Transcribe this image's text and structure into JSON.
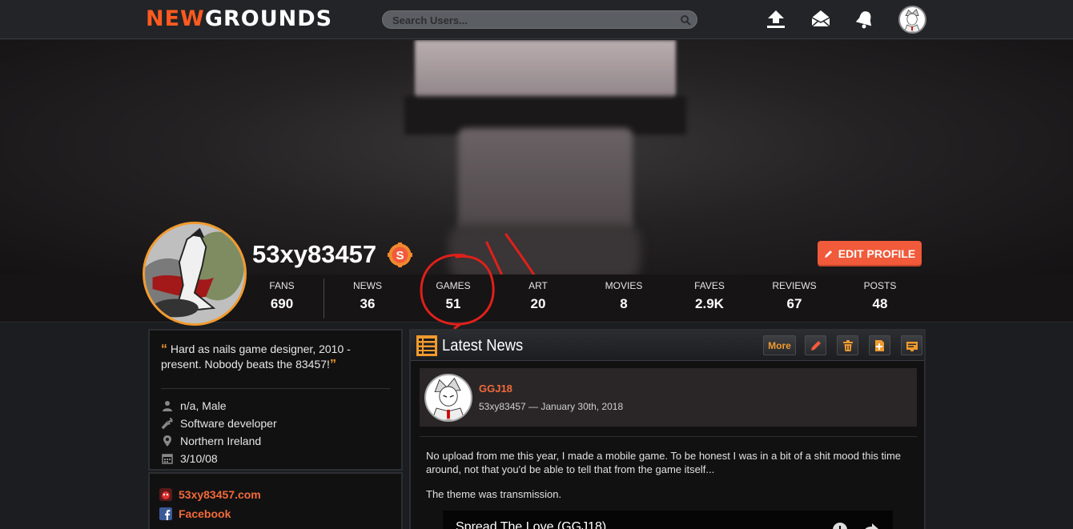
{
  "brand": {
    "logo_part1": "NEW",
    "logo_part2": "GROUNDS"
  },
  "search": {
    "placeholder": "Search Users..."
  },
  "topbar_icons": [
    "upload-icon",
    "mail-icon",
    "bell-icon",
    "user-avatar"
  ],
  "profile": {
    "username": "53xy83457",
    "edit_label": "EDIT PROFILE",
    "stats": [
      {
        "label": "FANS",
        "value": "690"
      },
      {
        "label": "NEWS",
        "value": "36"
      },
      {
        "label": "GAMES",
        "value": "51"
      },
      {
        "label": "ART",
        "value": "20"
      },
      {
        "label": "MOVIES",
        "value": "8"
      },
      {
        "label": "FAVES",
        "value": "2.9K"
      },
      {
        "label": "REVIEWS",
        "value": "67"
      },
      {
        "label": "POSTS",
        "value": "48"
      }
    ]
  },
  "bio": {
    "quote": "Hard as nails game designer, 2010 - present. Nobody beats the 83457!",
    "gender": "n/a, Male",
    "job": "Software developer",
    "location": "Northern Ireland",
    "joined": "3/10/08"
  },
  "links": [
    {
      "label": "53xy83457.com",
      "icon": "site-icon"
    },
    {
      "label": "Facebook",
      "icon": "facebook-icon"
    }
  ],
  "news": {
    "title": "Latest News",
    "more_label": "More",
    "post": {
      "title": "GGJ18",
      "meta": "53xy83457 — January 30th, 2018",
      "paragraph1": "No upload from me this year, I made a mobile game. To be honest I was in a bit of a shit mood this time around, not that you'd be able to tell that from the game itself...",
      "paragraph2": "The theme was transmission.",
      "video_title": "Spread The Love (GGJ18)"
    }
  },
  "colors": {
    "accent": "#f15a3a",
    "orange": "#f19a2e",
    "bg": "#1b1d20"
  }
}
